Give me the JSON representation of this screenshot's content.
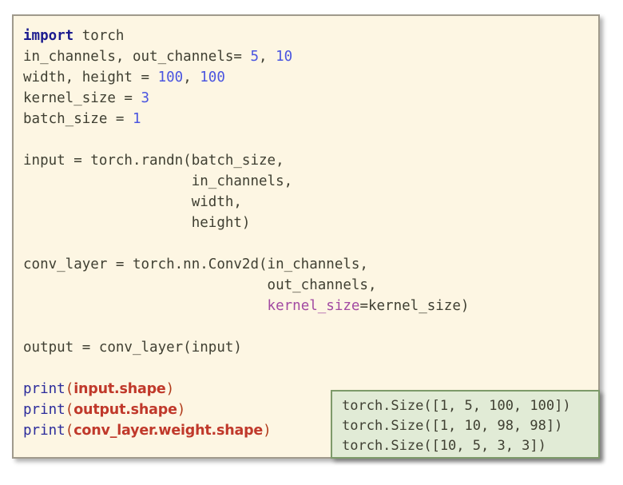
{
  "slide": {
    "background_color": "#ffffff",
    "code_card": {
      "background_color": "#fdf6e3",
      "border_color": "#a09a8c"
    },
    "output_card": {
      "background_color": "#e1ebd6",
      "border_color": "#7d9a6a"
    },
    "colors": {
      "keyword": "#1b1b8f",
      "number": "#4a55e0",
      "kwarg": "#a24aa2",
      "bold_arg": "#c0392b",
      "plain": "#3f3f32"
    }
  },
  "code": {
    "language": "python",
    "lines": [
      {
        "id": "line-01",
        "tokens": [
          {
            "t": "import",
            "c": "kw"
          },
          {
            "t": " torch",
            "c": "plain"
          }
        ]
      },
      {
        "id": "line-02",
        "tokens": [
          {
            "t": "in_channels, out_channels= ",
            "c": "plain"
          },
          {
            "t": "5",
            "c": "num"
          },
          {
            "t": ", ",
            "c": "plain"
          },
          {
            "t": "10",
            "c": "num"
          }
        ]
      },
      {
        "id": "line-03",
        "tokens": [
          {
            "t": "width, height = ",
            "c": "plain"
          },
          {
            "t": "100",
            "c": "num"
          },
          {
            "t": ", ",
            "c": "plain"
          },
          {
            "t": "100",
            "c": "num"
          }
        ]
      },
      {
        "id": "line-04",
        "tokens": [
          {
            "t": "kernel_size = ",
            "c": "plain"
          },
          {
            "t": "3",
            "c": "num"
          }
        ]
      },
      {
        "id": "line-05",
        "tokens": [
          {
            "t": "batch_size = ",
            "c": "plain"
          },
          {
            "t": "1",
            "c": "num"
          }
        ]
      },
      {
        "id": "line-06",
        "tokens": [
          {
            "t": "",
            "c": "plain"
          }
        ]
      },
      {
        "id": "line-07",
        "tokens": [
          {
            "t": "input = torch.randn(batch_size,",
            "c": "plain"
          }
        ]
      },
      {
        "id": "line-08",
        "tokens": [
          {
            "t": "                    in_channels,",
            "c": "plain"
          }
        ]
      },
      {
        "id": "line-09",
        "tokens": [
          {
            "t": "                    width,",
            "c": "plain"
          }
        ]
      },
      {
        "id": "line-10",
        "tokens": [
          {
            "t": "                    height)",
            "c": "plain"
          }
        ]
      },
      {
        "id": "line-11",
        "tokens": [
          {
            "t": "",
            "c": "plain"
          }
        ]
      },
      {
        "id": "line-12",
        "tokens": [
          {
            "t": "conv_layer = torch.nn.Conv2d(in_channels,",
            "c": "plain"
          }
        ]
      },
      {
        "id": "line-13",
        "tokens": [
          {
            "t": "                             out_channels,",
            "c": "plain"
          }
        ]
      },
      {
        "id": "line-14",
        "tokens": [
          {
            "t": "                             ",
            "c": "plain"
          },
          {
            "t": "kernel_size",
            "c": "kwarg"
          },
          {
            "t": "=kernel_size)",
            "c": "plain"
          }
        ]
      },
      {
        "id": "line-15",
        "tokens": [
          {
            "t": "",
            "c": "plain"
          }
        ]
      },
      {
        "id": "line-16",
        "tokens": [
          {
            "t": "output = conv_layer(input)",
            "c": "plain"
          }
        ]
      },
      {
        "id": "line-17",
        "tokens": [
          {
            "t": "",
            "c": "plain"
          }
        ]
      },
      {
        "id": "line-18",
        "tokens": [
          {
            "t": "print",
            "c": "fn"
          },
          {
            "t": "(",
            "c": "paren-r"
          },
          {
            "t": "input.shape",
            "c": "argbold"
          },
          {
            "t": ")",
            "c": "paren-r"
          }
        ]
      },
      {
        "id": "line-19",
        "tokens": [
          {
            "t": "print",
            "c": "fn"
          },
          {
            "t": "(",
            "c": "paren-r"
          },
          {
            "t": "output.shape",
            "c": "argbold"
          },
          {
            "t": ")",
            "c": "paren-r"
          }
        ]
      },
      {
        "id": "line-20",
        "tokens": [
          {
            "t": "print",
            "c": "fn"
          },
          {
            "t": "(",
            "c": "paren-r"
          },
          {
            "t": "conv_layer.weight.shape",
            "c": "argbold"
          },
          {
            "t": ")",
            "c": "paren-r"
          }
        ]
      }
    ]
  },
  "output": {
    "lines": [
      "torch.Size([1, 5, 100, 100])",
      "torch.Size([1, 10, 98, 98])",
      "torch.Size([10, 5, 3, 3])"
    ]
  }
}
